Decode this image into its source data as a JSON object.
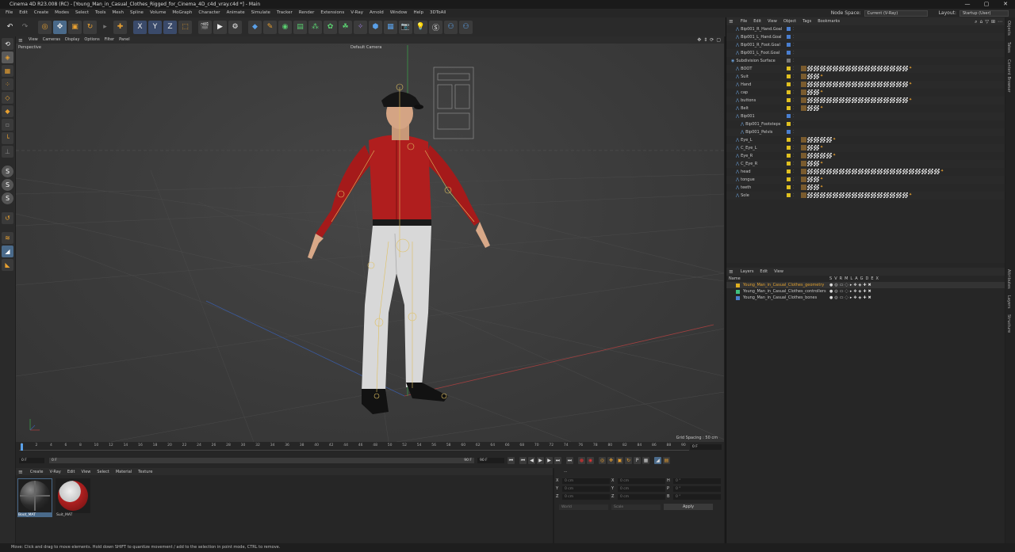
{
  "window": {
    "title": "Cinema 4D R23.008 (RC) - [Young_Man_in_Casual_Clothes_Rigged_for_Cinema_4D_c4d_vray.c4d *] - Main",
    "controls": [
      "—",
      "▢",
      "✕"
    ]
  },
  "menubar": {
    "items": [
      "File",
      "Edit",
      "Create",
      "Modes",
      "Select",
      "Tools",
      "Mesh",
      "Spline",
      "Volume",
      "MoGraph",
      "Character",
      "Animate",
      "Simulate",
      "Tracker",
      "Render",
      "Extensions",
      "V-Ray",
      "Arnold",
      "Window",
      "Help",
      "3DToAll"
    ],
    "node_space_label": "Node Space:",
    "node_space_value": "Current (V-Ray)",
    "layout_label": "Layout:",
    "layout_value": "Startup (User)"
  },
  "viewport": {
    "menu": [
      "View",
      "Cameras",
      "Display",
      "Options",
      "Filter",
      "Panel"
    ],
    "name": "Perspective",
    "camera": "Default Camera",
    "grid_spacing": "Grid Spacing : 50 cm"
  },
  "timeline": {
    "ticks": [
      "0",
      "2",
      "4",
      "6",
      "8",
      "10",
      "12",
      "14",
      "16",
      "18",
      "20",
      "22",
      "24",
      "26",
      "28",
      "30",
      "32",
      "34",
      "36",
      "38",
      "40",
      "42",
      "44",
      "46",
      "48",
      "50",
      "52",
      "54",
      "56",
      "58",
      "60",
      "62",
      "64",
      "66",
      "68",
      "70",
      "72",
      "74",
      "76",
      "78",
      "80",
      "82",
      "84",
      "86",
      "88",
      "90"
    ],
    "current_right": "0 F",
    "start_field": "0 F",
    "range_start": "0 F",
    "range_end": "90 F",
    "end_field": "90 F"
  },
  "object_manager": {
    "menu": [
      "File",
      "Edit",
      "View",
      "Object",
      "Tags",
      "Bookmarks"
    ],
    "rows": [
      {
        "name": "Bip001_R_Hand.Goal",
        "indent": 1,
        "color": "#4a7fd0",
        "tags": 0
      },
      {
        "name": "Bip001_L_Hand.Goal",
        "indent": 1,
        "color": "#4a7fd0",
        "tags": 0
      },
      {
        "name": "Bip001_R_Foot.Goal",
        "indent": 1,
        "color": "#4a7fd0",
        "tags": 0
      },
      {
        "name": "Bip001_L_Foot.Goal",
        "indent": 1,
        "color": "#4a7fd0",
        "tags": 0
      },
      {
        "name": "Subdivision Surface",
        "indent": 0,
        "color": "#777",
        "tags": 0
      },
      {
        "name": "BOOT",
        "indent": 1,
        "color": "#e0c020",
        "tags": 17
      },
      {
        "name": "Suit",
        "indent": 1,
        "color": "#e0c020",
        "tags": 3
      },
      {
        "name": "Hand",
        "indent": 1,
        "color": "#e0c020",
        "tags": 17
      },
      {
        "name": "cap",
        "indent": 1,
        "color": "#e0c020",
        "tags": 3
      },
      {
        "name": "buttons",
        "indent": 1,
        "color": "#e0c020",
        "tags": 17
      },
      {
        "name": "Belt",
        "indent": 1,
        "color": "#e0c020",
        "tags": 3
      },
      {
        "name": "Bip001",
        "indent": 1,
        "color": "#4a7fd0",
        "tags": 0
      },
      {
        "name": "Bip001_Footsteps",
        "indent": 2,
        "color": "#e0c020",
        "tags": 0
      },
      {
        "name": "Bip001_Pelvis",
        "indent": 2,
        "color": "#4a7fd0",
        "tags": 0
      },
      {
        "name": "Eye_L",
        "indent": 1,
        "color": "#e0c020",
        "tags": 5
      },
      {
        "name": "C_Eye_L",
        "indent": 1,
        "color": "#e0c020",
        "tags": 3
      },
      {
        "name": "Eye_R",
        "indent": 1,
        "color": "#e0c020",
        "tags": 5
      },
      {
        "name": "C_Eye_R",
        "indent": 1,
        "color": "#e0c020",
        "tags": 3
      },
      {
        "name": "head",
        "indent": 1,
        "color": "#e0c020",
        "tags": 22
      },
      {
        "name": "tongue",
        "indent": 1,
        "color": "#e0c020",
        "tags": 3
      },
      {
        "name": "teeth",
        "indent": 1,
        "color": "#e0c020",
        "tags": 3
      },
      {
        "name": "Sole",
        "indent": 1,
        "color": "#e0c020",
        "tags": 17
      }
    ]
  },
  "layers": {
    "menu": [
      "Layers",
      "Edit",
      "View"
    ],
    "header_name": "Name",
    "header_cols": [
      "S",
      "V",
      "R",
      "M",
      "L",
      "A",
      "G",
      "D",
      "E",
      "X"
    ],
    "rows": [
      {
        "name": "Young_Man_in_Casual_Clothes_geometry",
        "color": "#e0b020",
        "text_color": "#e0a030"
      },
      {
        "name": "Young_Man_in_Casual_Clothes_controllers",
        "color": "#3fbf7f",
        "text_color": "#c8c8c8"
      },
      {
        "name": "Young_Man_in_Casual_Clothes_bones",
        "color": "#4a7fd0",
        "text_color": "#c8c8c8"
      }
    ]
  },
  "side_tabs_top": [
    "Objects",
    "Takes",
    "Content Browser"
  ],
  "side_tabs_bottom": [
    "Attributes",
    "Layers",
    "Structure"
  ],
  "material_manager": {
    "menu": [
      "Create",
      "V-Ray",
      "Edit",
      "View",
      "Select",
      "Material",
      "Texture"
    ],
    "materials": [
      "Boot_MAT",
      "Suit_MAT"
    ]
  },
  "attributes": {
    "header": "--",
    "rows": [
      {
        "a": "X",
        "av": "0 cm",
        "b": "X",
        "bv": "0 cm",
        "c": "H",
        "cv": "0 °"
      },
      {
        "a": "Y",
        "av": "0 cm",
        "b": "Y",
        "bv": "0 cm",
        "c": "P",
        "cv": "0 °"
      },
      {
        "a": "Z",
        "av": "0 cm",
        "b": "Z",
        "bv": "0 cm",
        "c": "B",
        "cv": "0 °"
      }
    ],
    "coord_mode": "World",
    "scale_mode": "Scale",
    "apply": "Apply"
  },
  "status": "Move: Click and drag to move elements. Hold down SHIFT to quantize movement / add to the selection in point mode, CTRL to remove."
}
